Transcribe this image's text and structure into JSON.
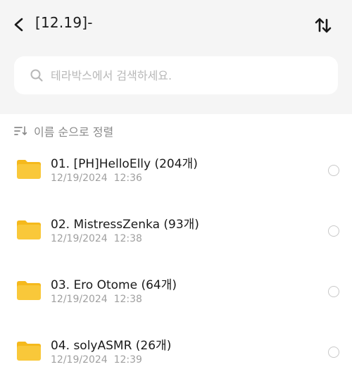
{
  "header": {
    "title": "[12.19]-",
    "back_icon": "chevron-left-icon",
    "sort_icon": "sort-arrows-icon"
  },
  "search": {
    "placeholder": "테라박스에서 검색하세요.",
    "value": ""
  },
  "sort": {
    "label": "이름 순으로 정렬"
  },
  "colors": {
    "folder": "#f9c83a",
    "folder_tab": "#f5b91c",
    "header_bg": "#f5f5f5",
    "muted_text": "#a0a0a0"
  },
  "folders": [
    {
      "title": "01. [PH]HelloElly (204개)",
      "date": "12/19/2024",
      "time": "12:36"
    },
    {
      "title": "02. MistressZenka (93개)",
      "date": "12/19/2024",
      "time": "12:38"
    },
    {
      "title": "03. Ero Otome (64개)",
      "date": "12/19/2024",
      "time": "12:38"
    },
    {
      "title": "04. solyASMR (26개)",
      "date": "12/19/2024",
      "time": "12:39"
    }
  ]
}
